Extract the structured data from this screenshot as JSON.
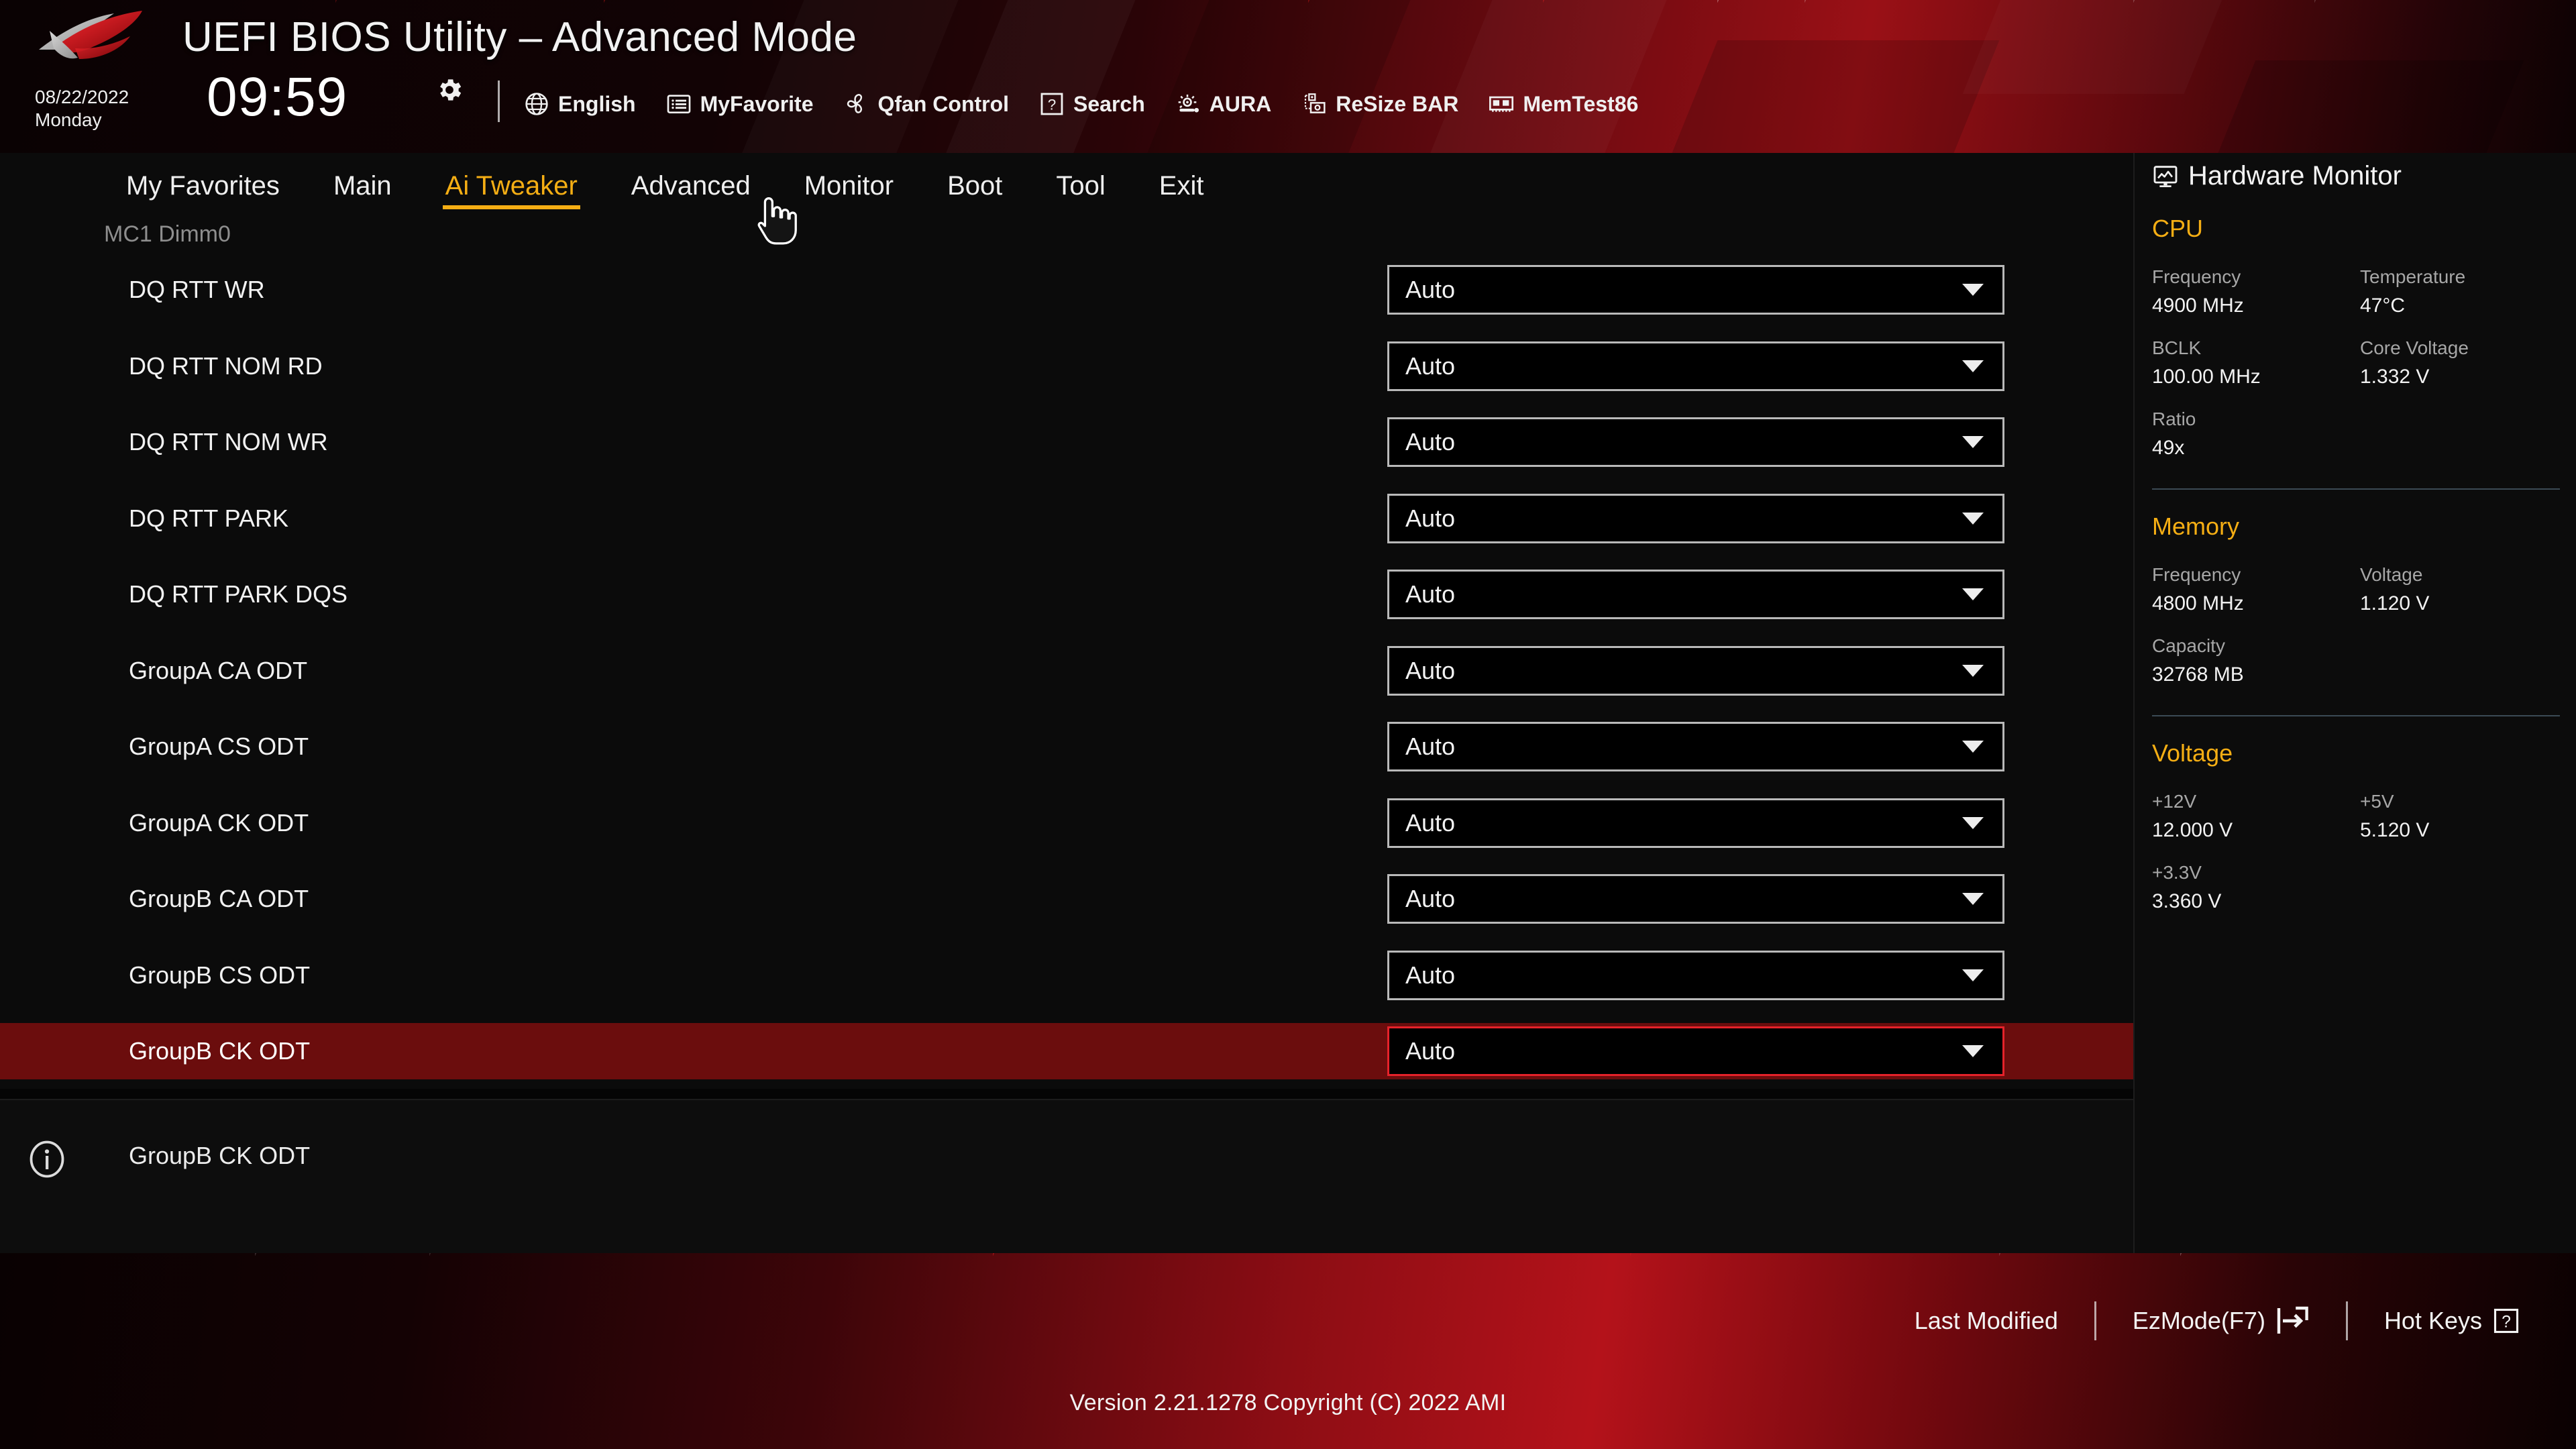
{
  "app": {
    "title": "UEFI BIOS Utility – Advanced Mode",
    "logo_name": "rog-logo"
  },
  "header": {
    "date": "08/22/2022",
    "day": "Monday",
    "time": "09:59",
    "gear_icon": "gear-icon",
    "tools": [
      {
        "label": "English",
        "icon": "globe-icon"
      },
      {
        "label": "MyFavorite",
        "icon": "favorites-list-icon"
      },
      {
        "label": "Qfan Control",
        "icon": "fan-icon"
      },
      {
        "label": "Search",
        "icon": "question-box-icon"
      },
      {
        "label": "AURA",
        "icon": "aura-light-icon"
      },
      {
        "label": "ReSize BAR",
        "icon": "gpu-card-icon"
      },
      {
        "label": "MemTest86",
        "icon": "memory-module-icon"
      }
    ]
  },
  "tabs": [
    {
      "label": "My Favorites",
      "active": false
    },
    {
      "label": "Main",
      "active": false
    },
    {
      "label": "Ai Tweaker",
      "active": true
    },
    {
      "label": "Advanced",
      "active": false
    },
    {
      "label": "Monitor",
      "active": false
    },
    {
      "label": "Boot",
      "active": false
    },
    {
      "label": "Tool",
      "active": false
    },
    {
      "label": "Exit",
      "active": false
    }
  ],
  "settings": {
    "group_header": "MC1 Dimm0",
    "rows": [
      {
        "label": "DQ RTT WR",
        "value": "Auto",
        "selected": false
      },
      {
        "label": "DQ RTT NOM RD",
        "value": "Auto",
        "selected": false
      },
      {
        "label": "DQ RTT NOM WR",
        "value": "Auto",
        "selected": false
      },
      {
        "label": "DQ RTT PARK",
        "value": "Auto",
        "selected": false
      },
      {
        "label": "DQ RTT PARK DQS",
        "value": "Auto",
        "selected": false
      },
      {
        "label": "GroupA CA ODT",
        "value": "Auto",
        "selected": false
      },
      {
        "label": "GroupA CS ODT",
        "value": "Auto",
        "selected": false
      },
      {
        "label": "GroupA CK ODT",
        "value": "Auto",
        "selected": false
      },
      {
        "label": "GroupB CA ODT",
        "value": "Auto",
        "selected": false
      },
      {
        "label": "GroupB CS ODT",
        "value": "Auto",
        "selected": false
      },
      {
        "label": "GroupB CK ODT",
        "value": "Auto",
        "selected": true
      }
    ]
  },
  "help": {
    "icon": "info-icon",
    "text": "GroupB CK ODT"
  },
  "hardware_monitor": {
    "title": "Hardware Monitor",
    "title_icon": "monitor-chart-icon",
    "sections": [
      {
        "name": "CPU",
        "items": [
          {
            "key": "Frequency",
            "value": "4900 MHz"
          },
          {
            "key": "Temperature",
            "value": "47°C"
          },
          {
            "key": "BCLK",
            "value": "100.00 MHz"
          },
          {
            "key": "Core Voltage",
            "value": "1.332 V"
          },
          {
            "key": "Ratio",
            "value": "49x"
          }
        ]
      },
      {
        "name": "Memory",
        "items": [
          {
            "key": "Frequency",
            "value": "4800 MHz"
          },
          {
            "key": "Voltage",
            "value": "1.120 V"
          },
          {
            "key": "Capacity",
            "value": "32768 MB"
          }
        ]
      },
      {
        "name": "Voltage",
        "items": [
          {
            "key": "+12V",
            "value": "12.000 V"
          },
          {
            "key": "+5V",
            "value": "5.120 V"
          },
          {
            "key": "+3.3V",
            "value": "3.360 V"
          }
        ]
      }
    ]
  },
  "footer": {
    "actions": [
      {
        "label": "Last Modified",
        "icon": ""
      },
      {
        "label": "EzMode(F7)",
        "icon": "exit-arrow-icon"
      },
      {
        "label": "Hot Keys",
        "icon": "question-box-icon"
      }
    ],
    "version": "Version 2.21.1278 Copyright (C) 2022 AMI"
  },
  "colors": {
    "accent_gold": "#f5ae14",
    "selection_red": "#6b0d0d",
    "selection_border": "#e5222a",
    "brand_red": "#b4121a"
  },
  "cursor": {
    "icon": "hand-pointer-cursor"
  }
}
